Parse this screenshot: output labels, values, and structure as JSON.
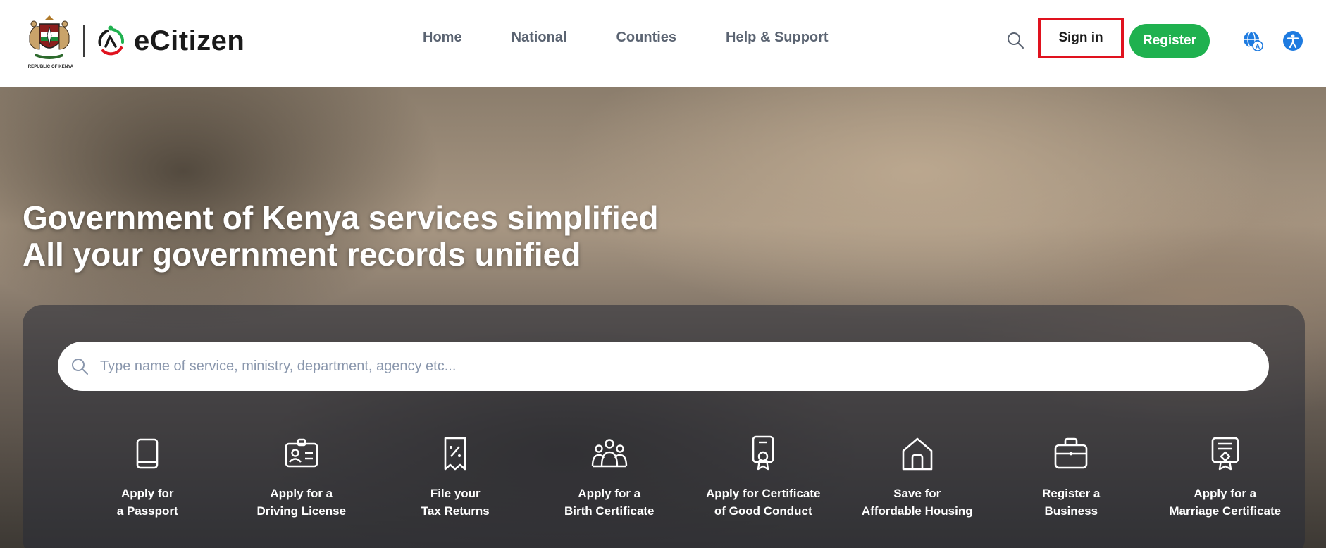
{
  "header": {
    "coat_caption": "REPUBLIC OF KENYA",
    "brand": "eCitizen",
    "nav": [
      {
        "label": "Home"
      },
      {
        "label": "National"
      },
      {
        "label": "Counties"
      },
      {
        "label": "Help & Support"
      }
    ],
    "sign_in_label": "Sign in",
    "register_label": "Register",
    "icons": {
      "search": "search-icon",
      "language": "language-icon",
      "accessibility": "accessibility-icon"
    }
  },
  "hero": {
    "line1": "Government of Kenya services simplified",
    "line2": "All your government records unified"
  },
  "search": {
    "placeholder": "Type name of service, ministry, department, agency etc...",
    "value": ""
  },
  "services": [
    {
      "line1": "Apply for",
      "line2": "a Passport",
      "icon": "passport-icon"
    },
    {
      "line1": "Apply for a",
      "line2": "Driving License",
      "icon": "id-card-icon"
    },
    {
      "line1": "File your",
      "line2": "Tax Returns",
      "icon": "receipt-percent-icon"
    },
    {
      "line1": "Apply for a",
      "line2": "Birth Certificate",
      "icon": "family-icon"
    },
    {
      "line1": "Apply for Certificate",
      "line2": "of Good Conduct",
      "icon": "certificate-badge-icon"
    },
    {
      "line1": "Save for",
      "line2": "Affordable Housing",
      "icon": "house-icon"
    },
    {
      "line1": "Register a",
      "line2": "Business",
      "icon": "briefcase-icon"
    },
    {
      "line1": "Apply for a",
      "line2": "Marriage Certificate",
      "icon": "marriage-certificate-icon"
    }
  ],
  "colors": {
    "brand_green": "#1fb14f",
    "highlight_red": "#e0121e",
    "nav_text": "#5b6472",
    "placeholder": "#8a97ad"
  }
}
